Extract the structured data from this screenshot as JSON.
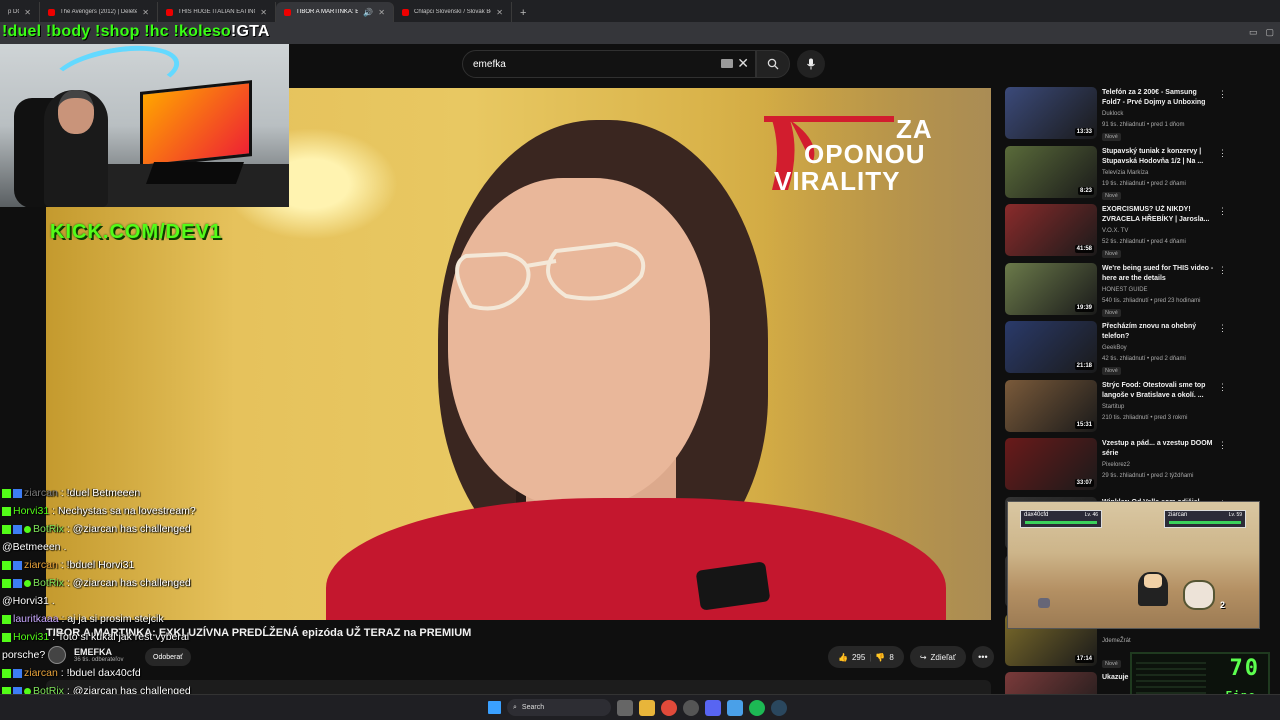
{
  "tabs": [
    {
      "title": "p DC"
    },
    {
      "title": "The Avengers (2012) | Deleted"
    },
    {
      "title": "THIS HUGE ITALIAN EATING CH"
    },
    {
      "title": "TIBOR A MARTINKA: EXKLU"
    },
    {
      "title": "Chlapci Slovenskí / Slovak Boys"
    }
  ],
  "overlay": {
    "commands": "!duel !body !shop !hc !koleso",
    "gta": "!GTA",
    "kick": "KICK.COM/DEV1"
  },
  "search": {
    "value": "emefka"
  },
  "video": {
    "logo_line1": "ZA",
    "logo_line2": "OPONOU",
    "logo_line3": "VIRALITY",
    "title": "TIBOR A MARTINKA: EXKLUZÍVNA PREDĹŽENÁ epizóda UŽ TERAZ na PREMIUM",
    "channel": "EMEFKA",
    "subscribers": "36 tis. odberateľov",
    "subscribe_label": "Odoberať",
    "likes": "295",
    "dislikes": "8",
    "share_label": "Zdieľať"
  },
  "chat": [
    {
      "user": "ziarcan",
      "text": "!duel Betmeeen"
    },
    {
      "user": "Horvi31",
      "text": "Nechystas sa na lovestream?"
    },
    {
      "user": "BotRix",
      "text": "@ziarcan has challenged"
    },
    {
      "user": "",
      "text": "@Betmeeen ."
    },
    {
      "user": "ziarcan",
      "text": "!bduel Horvi31"
    },
    {
      "user": "BotRix",
      "text": "@ziarcan has challenged"
    },
    {
      "user": "",
      "text": "@Horvi31 ."
    },
    {
      "user": "lauritkaaa",
      "text": "aj ja si prosim stejcik"
    },
    {
      "user": "Horvi31",
      "text": "Toto si kukal jak rest vyberal"
    },
    {
      "user": "",
      "text": "porsche?"
    },
    {
      "user": "ziarcan",
      "text": "!bduel dax40cfd"
    },
    {
      "user": "BotRix",
      "text": "@ziarcan has challenged"
    },
    {
      "user": "",
      "text": "@dax40cfd ."
    }
  ],
  "recommendations": [
    {
      "title": "Telefón za 2 200€ - Samsung Fold7 - Prvé Dojmy a Unboxing",
      "channel": "Duklock",
      "meta": "91 tis. zhliadnutí • pred 1 dňom",
      "duration": "13:33",
      "badge": "Nové",
      "color": "#3b4a7a"
    },
    {
      "title": "Stupavský tuniak z konzervy | Stupavská Hodovňa 1/2 | Na ...",
      "channel": "Televízia Markíza",
      "meta": "19 tis. zhliadnutí • pred 2 dňami",
      "duration": "8:23",
      "badge": "Nové",
      "color": "#5a6b3a"
    },
    {
      "title": "EXORCISMUS? UŽ NIKDY! ZVRACELA HŘEBÍKY | Jarosla...",
      "channel": "V.O.X. TV",
      "meta": "52 tis. zhliadnutí • pred 4 dňami",
      "duration": "41:58",
      "badge": "Nové",
      "color": "#8a2b2b"
    },
    {
      "title": "We're being sued for THIS video - here are the details",
      "channel": "HONEST GUIDE",
      "meta": "540 tis. zhliadnutí • pred 23 hodinami",
      "duration": "19:39",
      "badge": "Nové",
      "color": "#6b7a4a"
    },
    {
      "title": "Přecházím znovu na ohebný telefon?",
      "channel": "GeekBoy",
      "meta": "42 tis. zhliadnutí • pred 2 dňami",
      "duration": "21:18",
      "badge": "Nové",
      "color": "#2a3a6a"
    },
    {
      "title": "Strýc Food: Otestovali sme top langoše v Bratislave a okolí. ...",
      "channel": "Startitup",
      "meta": "210 tis. zhliadnutí • pred 3 rokmi",
      "duration": "15:31",
      "badge": "",
      "color": "#7a5a3a"
    },
    {
      "title": "Vzestup a pád... a vzestup DOOM série",
      "channel": "Pixelorez2",
      "meta": "29 tis. zhliadnutí • pred 2 týždňami",
      "duration": "33:07",
      "badge": "",
      "color": "#6a1a1a"
    },
    {
      "title": "Winkler: Od Valla som odišiel",
      "channel": "",
      "meta": "",
      "duration": "",
      "badge": "",
      "color": "#333"
    },
    {
      "title": "",
      "channel": "",
      "meta": "",
      "duration": "",
      "badge": "",
      "color": "#333"
    },
    {
      "title": "Uprava Recenzí: Puzzle Salad!",
      "channel": "JdemeŽrát",
      "meta": "",
      "duration": "17:14",
      "badge": "Nové",
      "color": "#7a6a2a"
    },
    {
      "title": "Ukazuje odvahu",
      "channel": "",
      "meta": "",
      "duration": "",
      "badge": "",
      "color": "#7a3a3a"
    }
  ],
  "game": {
    "player1": "dax40cfd",
    "player1_lv": "Lv. 46",
    "player2": "ziarcan",
    "player2_lv": "Lv. 59",
    "hits": "2"
  },
  "counter": {
    "value": "70",
    "label": "Fine"
  },
  "taskbar": {
    "search": "Search"
  }
}
